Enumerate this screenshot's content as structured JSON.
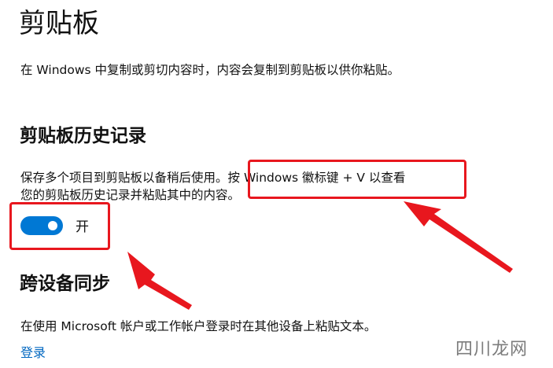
{
  "page": {
    "title": "剪贴板",
    "intro": "在 Windows 中复制或剪切内容时，内容会复制到剪贴板以供你粘贴。"
  },
  "clipboard_history": {
    "heading": "剪贴板历史记录",
    "description_part1": "保存多个项目到剪贴板以备稍后使用。",
    "description_shortcut": "按 Windows 徽标键 + V 以查看",
    "description_part2": "您的剪贴板历史记录并粘贴其中的内容。",
    "toggle": {
      "state": "on",
      "label": "开",
      "color": "#0078d4"
    }
  },
  "sync": {
    "heading": "跨设备同步",
    "description": "在使用 Microsoft 帐户或工作帐户登录时在其他设备上粘贴文本。",
    "login_link": "登录"
  },
  "annotations": {
    "color": "#e8171e"
  },
  "watermark": {
    "text": "四川龙网"
  }
}
